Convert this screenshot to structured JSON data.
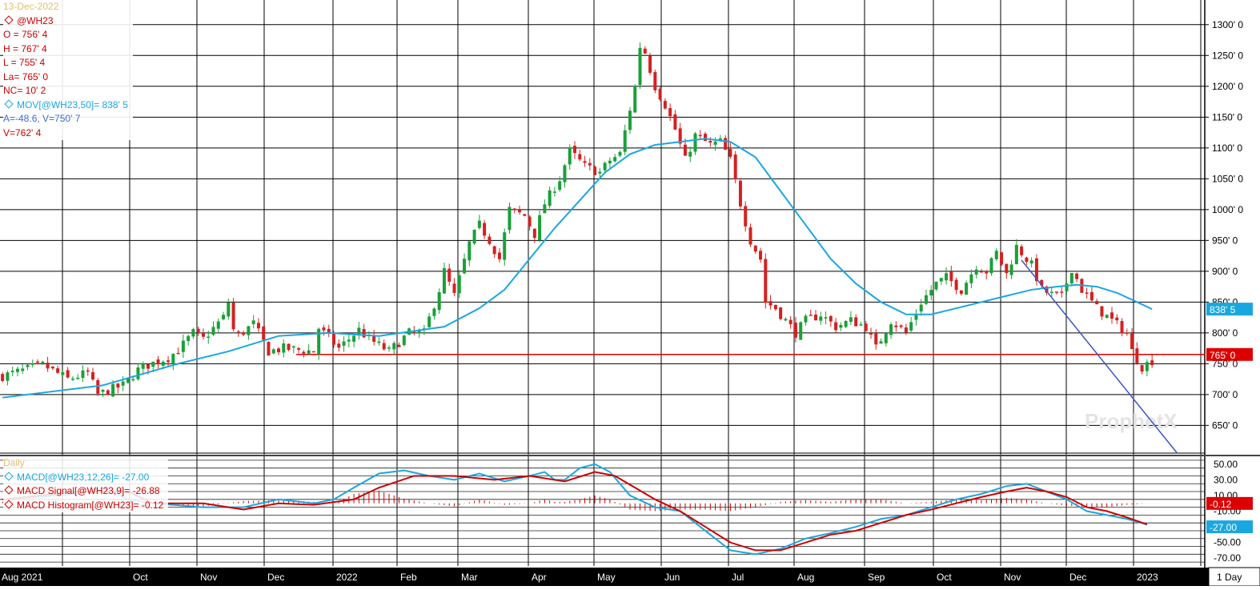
{
  "chart_data": [
    {
      "type": "candlestick",
      "symbol": "@WH23",
      "date_faint": "13-Dec-2022",
      "readouts": {
        "open": "O = 756' 4",
        "high": "H = 767' 4",
        "low": "L = 755' 4",
        "last": "La= 765' 0",
        "net_change": "NC= 10' 2",
        "moving_average": "MOV[@WH23,50]= 838' 5",
        "angle_value": "A=-48.6, V=750' 7",
        "value": "V=762' 4"
      },
      "y_ticks": [
        "1300' 0",
        "1250' 0",
        "1200' 0",
        "1150' 0",
        "1100' 0",
        "1050' 0",
        "1000' 0",
        "950' 0",
        "900' 0",
        "850' 0",
        "800' 0",
        "750' 0",
        "700' 0",
        "650' 0"
      ],
      "ylim": [
        605,
        1340
      ],
      "x_tick_labels": [
        "Aug 2021",
        "Oct",
        "Nov",
        "Dec",
        "2022",
        "Feb",
        "Mar",
        "Apr",
        "May",
        "Jun",
        "Jul",
        "Aug",
        "Sep",
        "Oct",
        "Nov",
        "Dec",
        "2023"
      ],
      "interval_label": "1 Day",
      "watermark": "ProphetX",
      "last_price_label": "765' 0",
      "last_price": 765,
      "ma_label": "838' 5",
      "ma_last": 838.6,
      "horizontal_line": 765,
      "close_path": [
        [
          0,
          730
        ],
        [
          8,
          748
        ],
        [
          13,
          725
        ],
        [
          17,
          735
        ],
        [
          19,
          700
        ],
        [
          24,
          715
        ],
        [
          27,
          740
        ],
        [
          29,
          748
        ],
        [
          33,
          760
        ],
        [
          35,
          772
        ],
        [
          38,
          800
        ],
        [
          40,
          790
        ],
        [
          44,
          825
        ],
        [
          45,
          850
        ],
        [
          46,
          805
        ],
        [
          47,
          795
        ],
        [
          50,
          815
        ],
        [
          53,
          770
        ],
        [
          56,
          775
        ],
        [
          62,
          770
        ],
        [
          63,
          808
        ],
        [
          67,
          775
        ],
        [
          71,
          805
        ],
        [
          73,
          790
        ],
        [
          77,
          770
        ],
        [
          81,
          800
        ],
        [
          84,
          800
        ],
        [
          87,
          870
        ],
        [
          88,
          900
        ],
        [
          90,
          860
        ],
        [
          93,
          945
        ],
        [
          95,
          975
        ],
        [
          97,
          950
        ],
        [
          99,
          920
        ],
        [
          101,
          1000
        ],
        [
          104,
          990
        ],
        [
          106,
          960
        ],
        [
          108,
          1010
        ],
        [
          111,
          1050
        ],
        [
          113,
          1095
        ],
        [
          116,
          1070
        ],
        [
          119,
          1060
        ],
        [
          121,
          1080
        ],
        [
          123,
          1090
        ],
        [
          126,
          1200
        ],
        [
          127,
          1265
        ],
        [
          128,
          1255
        ],
        [
          130,
          1200
        ],
        [
          132,
          1170
        ],
        [
          134,
          1130
        ],
        [
          136,
          1080
        ],
        [
          138,
          1120
        ],
        [
          141,
          1105
        ],
        [
          143,
          1110
        ],
        [
          145,
          1080
        ],
        [
          147,
          1010
        ],
        [
          149,
          950
        ],
        [
          151,
          920
        ],
        [
          152,
          850
        ],
        [
          154,
          840
        ],
        [
          156,
          820
        ],
        [
          158,
          800
        ],
        [
          160,
          820
        ],
        [
          163,
          830
        ],
        [
          166,
          810
        ],
        [
          169,
          820
        ],
        [
          172,
          810
        ],
        [
          174,
          775
        ],
        [
          177,
          820
        ],
        [
          180,
          800
        ],
        [
          183,
          850
        ],
        [
          186,
          880
        ],
        [
          188,
          890
        ],
        [
          191,
          870
        ],
        [
          194,
          910
        ],
        [
          196,
          900
        ],
        [
          198,
          930
        ],
        [
          200,
          895
        ],
        [
          202,
          940
        ],
        [
          205,
          910
        ],
        [
          207,
          870
        ],
        [
          209,
          862
        ],
        [
          211,
          858
        ],
        [
          213,
          905
        ],
        [
          215,
          870
        ],
        [
          218,
          840
        ],
        [
          221,
          820
        ],
        [
          224,
          800
        ],
        [
          225,
          770
        ],
        [
          227,
          745
        ],
        [
          229,
          755
        ]
      ],
      "ma_path": [
        [
          0,
          695
        ],
        [
          20,
          715
        ],
        [
          35,
          750
        ],
        [
          45,
          770
        ],
        [
          55,
          795
        ],
        [
          65,
          800
        ],
        [
          75,
          795
        ],
        [
          88,
          810
        ],
        [
          95,
          840
        ],
        [
          100,
          870
        ],
        [
          105,
          920
        ],
        [
          110,
          970
        ],
        [
          115,
          1015
        ],
        [
          120,
          1060
        ],
        [
          125,
          1090
        ],
        [
          130,
          1105
        ],
        [
          140,
          1115
        ],
        [
          145,
          1110
        ],
        [
          150,
          1085
        ],
        [
          155,
          1030
        ],
        [
          160,
          975
        ],
        [
          165,
          920
        ],
        [
          170,
          880
        ],
        [
          175,
          850
        ],
        [
          180,
          830
        ],
        [
          185,
          830
        ],
        [
          190,
          840
        ],
        [
          195,
          850
        ],
        [
          200,
          860
        ],
        [
          205,
          870
        ],
        [
          210,
          875
        ],
        [
          214,
          878
        ],
        [
          218,
          875
        ],
        [
          222,
          865
        ],
        [
          226,
          850
        ],
        [
          229,
          838.6
        ]
      ],
      "trendline": [
        [
          203,
          918
        ],
        [
          234,
          605
        ]
      ]
    },
    {
      "type": "line",
      "title": "MACD",
      "legend": [
        "MACD[@WH23,12,26]= -27.00",
        "MACD Signal[@WH23,9]= -26.88",
        "MACD Histogram[@WH23]= -0.12"
      ],
      "faint_label": "Daily",
      "y_ticks": [
        "50.00",
        "30.00",
        "10.00",
        "-10.00",
        "-30.00",
        "-50.00",
        "-70.00"
      ],
      "ylim": [
        -80,
        60
      ],
      "series": [
        {
          "name": "MACD[@WH23,12,26]",
          "color": "#1aa7e0",
          "points": [
            [
              0,
              5
            ],
            [
              15,
              12
            ],
            [
              20,
              20
            ],
            [
              25,
              5
            ],
            [
              30,
              0
            ],
            [
              40,
              -5
            ],
            [
              48,
              -5
            ],
            [
              55,
              5
            ],
            [
              62,
              0
            ],
            [
              66,
              5
            ],
            [
              70,
              20
            ],
            [
              75,
              38
            ],
            [
              80,
              42
            ],
            [
              85,
              35
            ],
            [
              90,
              30
            ],
            [
              95,
              38
            ],
            [
              100,
              28
            ],
            [
              105,
              35
            ],
            [
              108,
              40
            ],
            [
              110,
              30
            ],
            [
              112,
              30
            ],
            [
              115,
              45
            ],
            [
              118,
              50
            ],
            [
              121,
              40
            ],
            [
              125,
              10
            ],
            [
              130,
              -5
            ],
            [
              135,
              -10
            ],
            [
              140,
              -35
            ],
            [
              145,
              -60
            ],
            [
              150,
              -65
            ],
            [
              155,
              -58
            ],
            [
              160,
              -45
            ],
            [
              165,
              -38
            ],
            [
              170,
              -30
            ],
            [
              175,
              -20
            ],
            [
              180,
              -15
            ],
            [
              185,
              -5
            ],
            [
              190,
              5
            ],
            [
              195,
              12
            ],
            [
              200,
              22
            ],
            [
              204,
              25
            ],
            [
              208,
              15
            ],
            [
              212,
              5
            ],
            [
              216,
              -10
            ],
            [
              220,
              -15
            ],
            [
              224,
              -20
            ],
            [
              228,
              -27
            ]
          ]
        },
        {
          "name": "MACD Signal[@WH23,9]",
          "color": "#cc0000",
          "points": [
            [
              0,
              5
            ],
            [
              15,
              15
            ],
            [
              25,
              15
            ],
            [
              30,
              0
            ],
            [
              40,
              0
            ],
            [
              48,
              -8
            ],
            [
              55,
              0
            ],
            [
              62,
              -2
            ],
            [
              70,
              5
            ],
            [
              75,
              20
            ],
            [
              82,
              35
            ],
            [
              90,
              35
            ],
            [
              98,
              30
            ],
            [
              105,
              35
            ],
            [
              112,
              28
            ],
            [
              118,
              40
            ],
            [
              122,
              35
            ],
            [
              126,
              20
            ],
            [
              130,
              5
            ],
            [
              135,
              -10
            ],
            [
              140,
              -30
            ],
            [
              145,
              -50
            ],
            [
              150,
              -60
            ],
            [
              155,
              -60
            ],
            [
              160,
              -50
            ],
            [
              165,
              -40
            ],
            [
              170,
              -35
            ],
            [
              175,
              -25
            ],
            [
              180,
              -15
            ],
            [
              185,
              -8
            ],
            [
              190,
              0
            ],
            [
              195,
              8
            ],
            [
              200,
              15
            ],
            [
              204,
              20
            ],
            [
              208,
              15
            ],
            [
              212,
              8
            ],
            [
              216,
              -5
            ],
            [
              220,
              -10
            ],
            [
              224,
              -18
            ],
            [
              228,
              -26.88
            ]
          ]
        },
        {
          "name": "MACD Histogram[@WH23]",
          "color": "#cc0000",
          "points": [
            [
              0,
              2
            ],
            [
              15,
              -2
            ],
            [
              20,
              4
            ],
            [
              25,
              -8
            ],
            [
              30,
              0
            ],
            [
              40,
              -4
            ],
            [
              48,
              3
            ],
            [
              55,
              4
            ],
            [
              62,
              2
            ],
            [
              66,
              0
            ],
            [
              70,
              12
            ],
            [
              75,
              16
            ],
            [
              80,
              6
            ],
            [
              85,
              0
            ],
            [
              90,
              -4
            ],
            [
              95,
              5
            ],
            [
              100,
              -2
            ],
            [
              105,
              0
            ],
            [
              108,
              5
            ],
            [
              110,
              2
            ],
            [
              112,
              2
            ],
            [
              115,
              5
            ],
            [
              118,
              10
            ],
            [
              121,
              5
            ],
            [
              125,
              -8
            ],
            [
              130,
              -10
            ],
            [
              135,
              -8
            ],
            [
              140,
              -8
            ],
            [
              145,
              -10
            ],
            [
              150,
              -5
            ],
            [
              155,
              2
            ],
            [
              160,
              4
            ],
            [
              165,
              2
            ],
            [
              170,
              5
            ],
            [
              175,
              5
            ],
            [
              180,
              0
            ],
            [
              185,
              2
            ],
            [
              190,
              5
            ],
            [
              195,
              4
            ],
            [
              200,
              7
            ],
            [
              204,
              5
            ],
            [
              208,
              0
            ],
            [
              212,
              -3
            ],
            [
              216,
              -5
            ],
            [
              220,
              -5
            ],
            [
              224,
              -2
            ],
            [
              228,
              -0.12
            ]
          ]
        }
      ],
      "last_labels": {
        "histogram": "-0.12",
        "macd": "-27.00"
      },
      "last_values": {
        "histogram": -0.12,
        "macd": -27
      }
    }
  ],
  "colors": {
    "up": "#1aa038",
    "down": "#d62020",
    "ma": "#1aa7e0",
    "trend": "#3b55c8",
    "hline": "#dd0000",
    "grid": "#000000",
    "axis_bg": "#000000"
  }
}
